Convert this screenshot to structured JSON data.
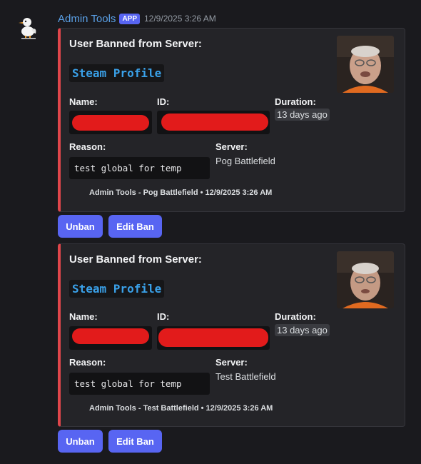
{
  "message": {
    "author": "Admin Tools",
    "badge": "APP",
    "timestamp": "12/9/2025 3:26 AM",
    "avatar_icon": "duck-logo-icon"
  },
  "colors": {
    "embed_accent": "#e0464b",
    "button": "#5865f2",
    "link": "#3aa1e9",
    "username": "#5aa0e6",
    "redaction": "#e21b1b"
  },
  "embeds": [
    {
      "title": "User Banned from Server:",
      "link_text": "Steam Profile",
      "name_label": "Name:",
      "id_label": "ID:",
      "duration_label": "Duration:",
      "duration_value": "13 days ago",
      "reason_label": "Reason:",
      "reason_value": "test global for temp",
      "server_label": "Server:",
      "server_value": "Pog Battlefield",
      "footer": "Admin Tools - Pog Battlefield • 12/9/2025 3:26 AM",
      "buttons": {
        "unban": "Unban",
        "edit": "Edit Ban"
      }
    },
    {
      "title": "User Banned from Server:",
      "link_text": "Steam Profile",
      "name_label": "Name:",
      "id_label": "ID:",
      "duration_label": "Duration:",
      "duration_value": "13 days ago",
      "reason_label": "Reason:",
      "reason_value": "test global for temp",
      "server_label": "Server:",
      "server_value": "Test Battlefield",
      "footer": "Admin Tools - Test Battlefield • 12/9/2025 3:26 AM",
      "buttons": {
        "unban": "Unban",
        "edit": "Edit Ban"
      }
    }
  ]
}
